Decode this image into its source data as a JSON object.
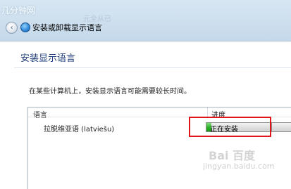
{
  "watermark_top": {
    "site": "几分钟网",
    "ghost_text": "元全从已"
  },
  "navigation": {
    "back_glyph": "‹",
    "window_title": "安装或卸载显示语言"
  },
  "main": {
    "heading": "安装显示语言",
    "description": "在某些计算机上，安装显示语言可能需要较长时间。"
  },
  "table": {
    "columns": [
      "语言",
      "进度"
    ],
    "rows": [
      {
        "language": "拉脱维亚语 (latviešu)",
        "status": "正在安装",
        "progress_fraction": 0.08
      }
    ]
  },
  "watermark_bottom": {
    "brand": "Bai 百度",
    "url": "jingyan.baidu.com"
  },
  "colors": {
    "heading": "#1e3d7a",
    "progress_green": "#2fb52b",
    "highlight_red": "#e0141a"
  }
}
